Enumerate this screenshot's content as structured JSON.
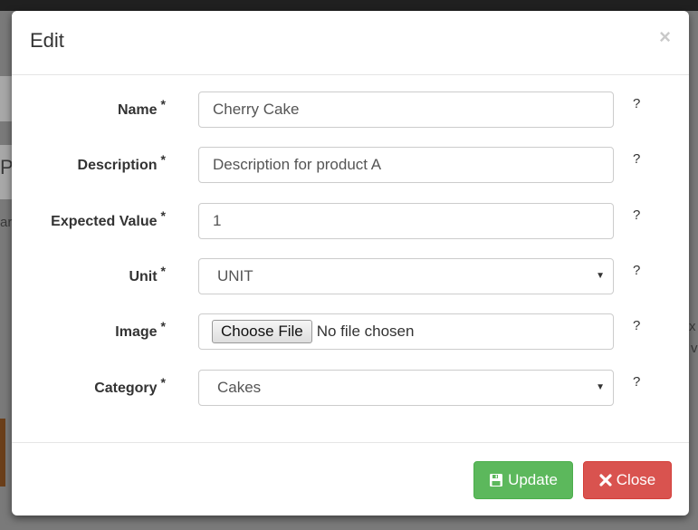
{
  "modal": {
    "title": "Edit",
    "close_symbol": "×"
  },
  "form": {
    "required_marker": "*",
    "help_marker": "?",
    "fields": {
      "name": {
        "label": "Name",
        "value": "Cherry Cake"
      },
      "description": {
        "label": "Description",
        "value": "Description for product A"
      },
      "expected_value": {
        "label": "Expected Value",
        "value": "1"
      },
      "unit": {
        "label": "Unit",
        "selected": "UNIT"
      },
      "image": {
        "label": "Image",
        "button_label": "Choose File",
        "status": "No file chosen"
      },
      "category": {
        "label": "Category",
        "selected": "Cakes"
      }
    }
  },
  "footer": {
    "update_label": "Update",
    "close_label": "Close"
  },
  "background": {
    "fragments": [
      "P",
      "ar",
      "x",
      "v"
    ]
  },
  "colors": {
    "update_button": "#5cb85c",
    "close_button": "#d9534f",
    "overlay": "#7a7a7a"
  },
  "icons": {
    "update": "floppy-disk-icon",
    "close": "x-icon",
    "select": "caret-down-icon"
  }
}
